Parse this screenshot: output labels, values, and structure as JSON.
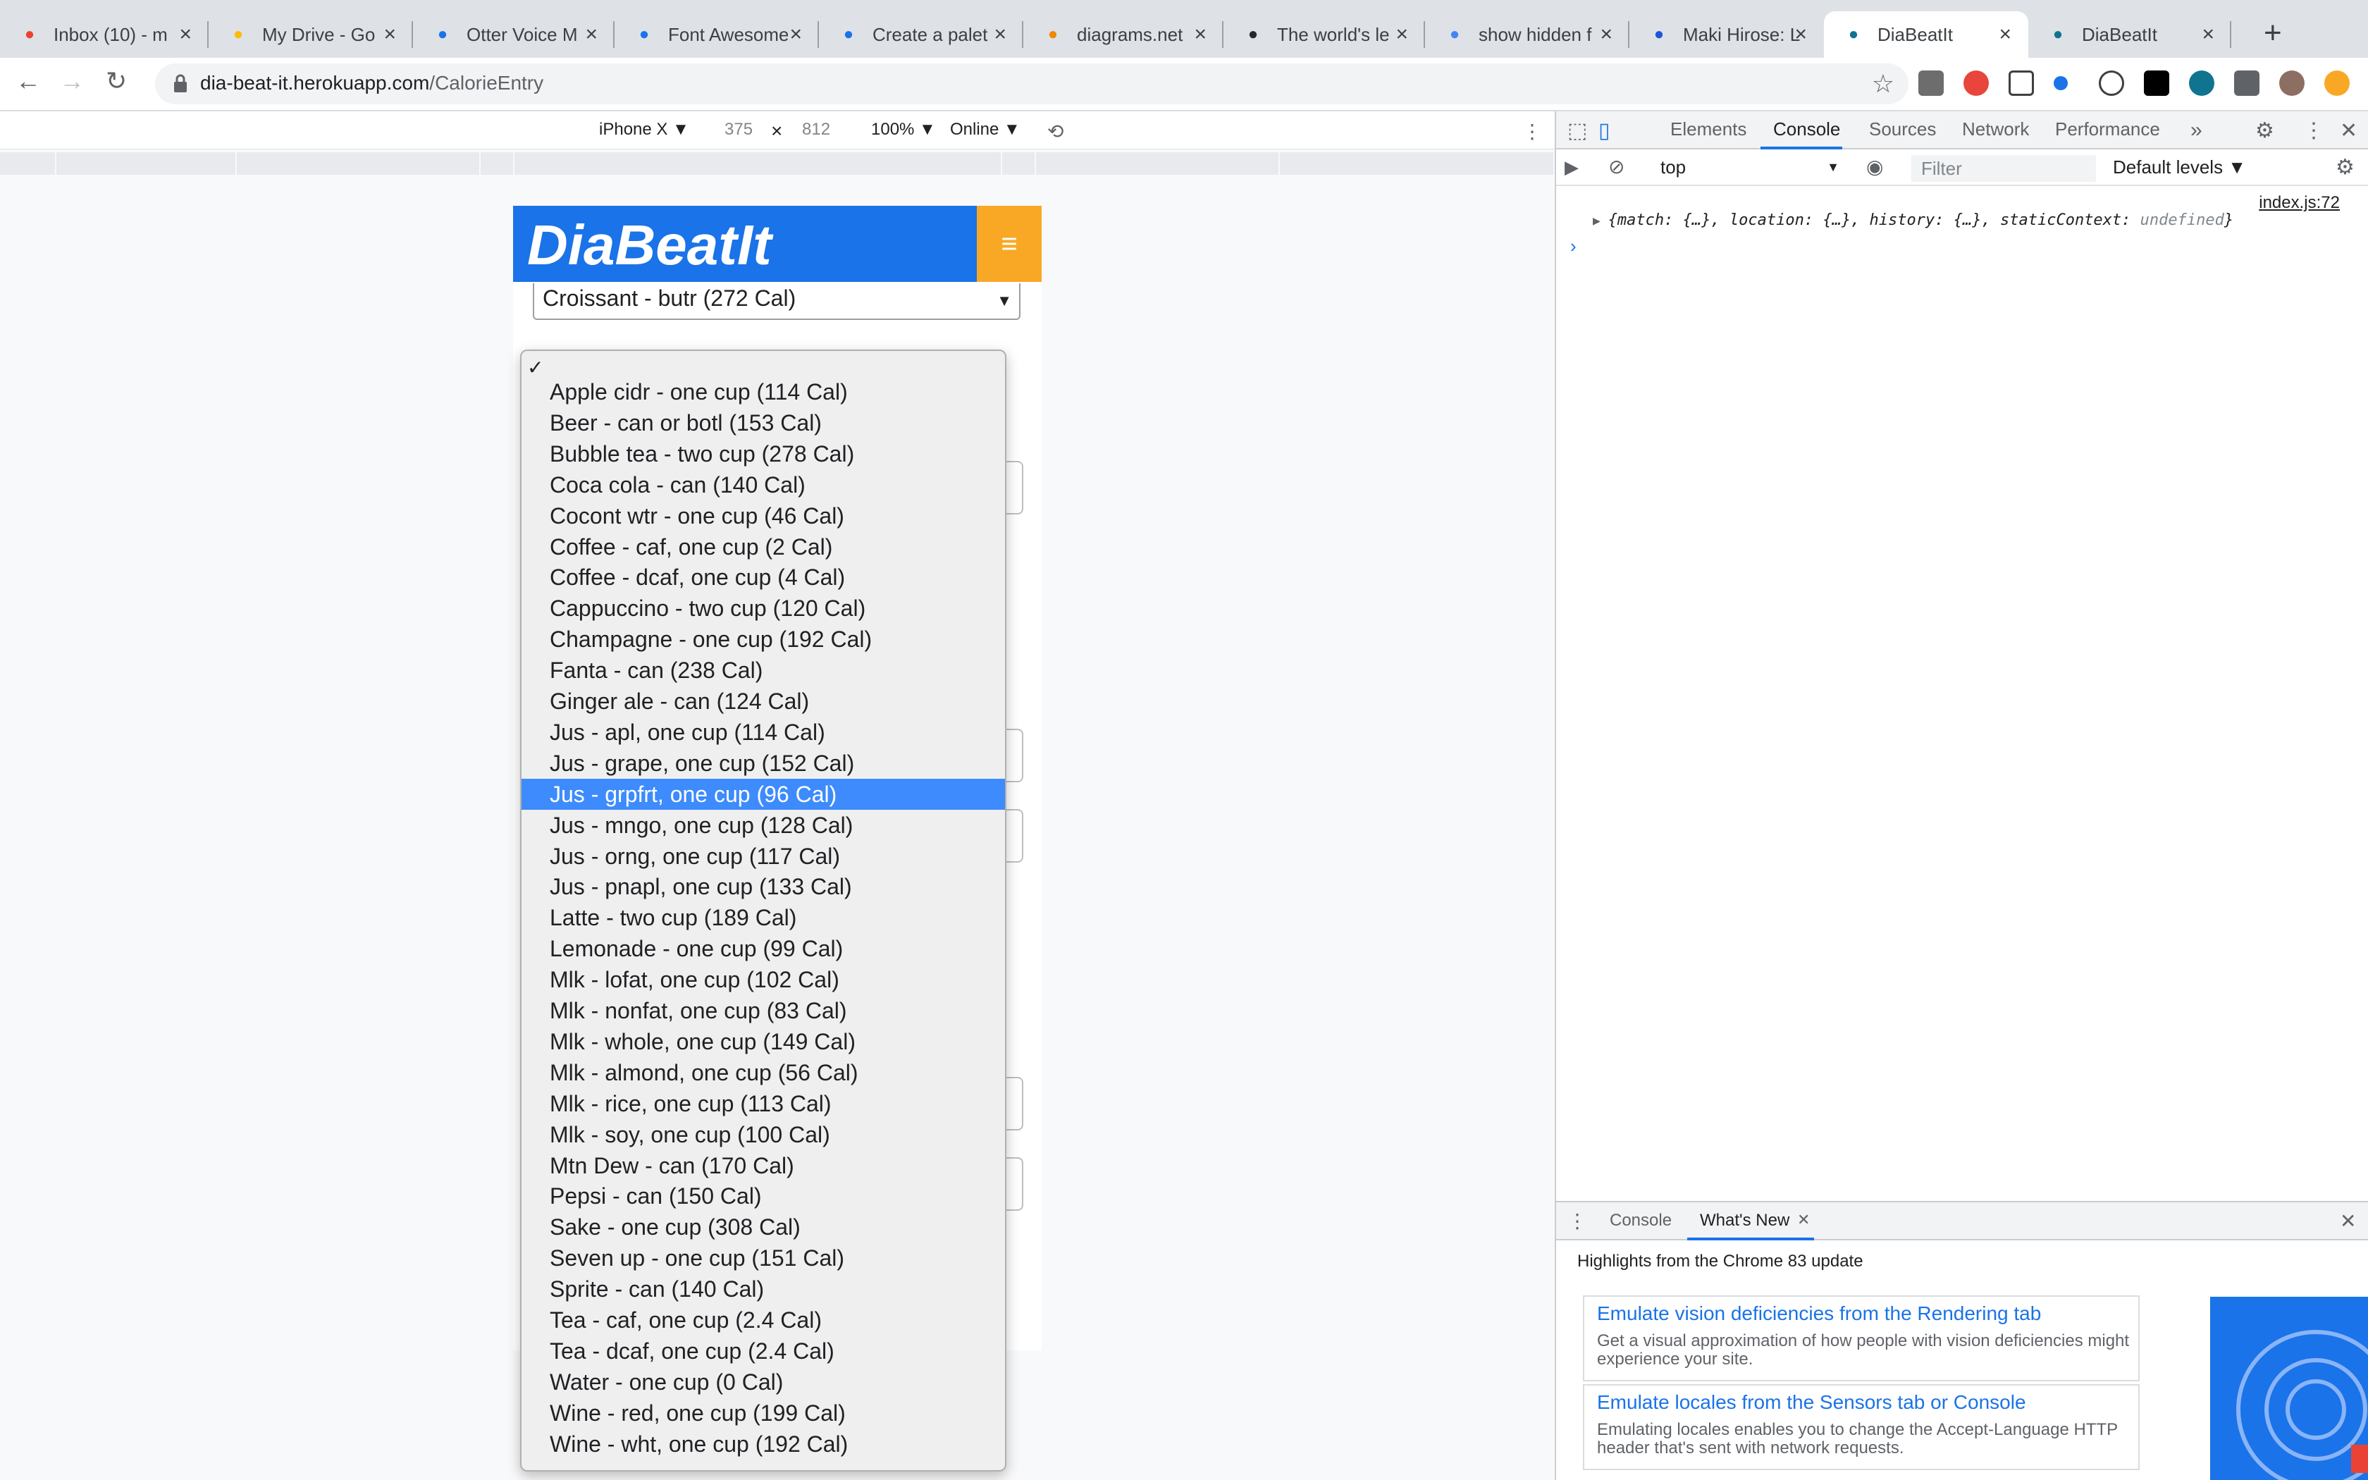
{
  "browser": {
    "tabs": [
      {
        "title": "Inbox (10) - m",
        "icon": "gmail-icon",
        "color": "#ea4335"
      },
      {
        "title": "My Drive - Go",
        "icon": "drive-icon",
        "color": "#fbbc04"
      },
      {
        "title": "Otter Voice M",
        "icon": "otter-icon",
        "color": "#1a73e8"
      },
      {
        "title": "Font Awesome",
        "icon": "flag-icon",
        "color": "#1a73e8"
      },
      {
        "title": "Create a palet",
        "icon": "coolors-icon",
        "color": "#1a73e8"
      },
      {
        "title": "diagrams.net",
        "icon": "diagrams-icon",
        "color": "#f08705"
      },
      {
        "title": "The world's le",
        "icon": "github-icon",
        "color": "#24292e"
      },
      {
        "title": "show hidden f",
        "icon": "google-icon",
        "color": "#4285f4"
      },
      {
        "title": "Maki Hirose: L",
        "icon": "square-icon",
        "color": "#1a56db"
      },
      {
        "title": "DiaBeatIt",
        "icon": "react-icon",
        "color": "#0e7490"
      },
      {
        "title": "DiaBeatIt",
        "icon": "react-icon",
        "color": "#0e7490"
      }
    ],
    "url_host": "dia-beat-it.herokuapp.com",
    "url_path": "/CalorieEntry"
  },
  "device": {
    "model": "iPhone X ▼",
    "width": "375",
    "times": "×",
    "height": "812",
    "zoom": "100% ▼",
    "network": "Online ▼"
  },
  "app": {
    "brand": "DiaBeatIt",
    "menu_icon": "≡",
    "selected_food": "Croissant - butr (272 Cal)"
  },
  "dropdown": {
    "check": "✓",
    "selected_index": 13,
    "options": [
      "Apple cidr - one cup (114 Cal)",
      "Beer - can or botl (153 Cal)",
      "Bubble tea - two cup (278 Cal)",
      "Coca cola - can (140 Cal)",
      "Cocont wtr - one cup (46 Cal)",
      "Coffee - caf, one cup (2 Cal)",
      "Coffee - dcaf, one cup (4 Cal)",
      "Cappuccino - two cup (120 Cal)",
      "Champagne - one cup (192 Cal)",
      "Fanta - can (238 Cal)",
      "Ginger ale - can (124 Cal)",
      "Jus - apl, one cup (114 Cal)",
      "Jus - grape, one cup (152 Cal)",
      "Jus - grpfrt, one cup (96 Cal)",
      "Jus - mngo, one cup (128 Cal)",
      "Jus - orng, one cup (117 Cal)",
      "Jus - pnapl, one cup (133 Cal)",
      "Latte - two cup (189 Cal)",
      "Lemonade - one cup (99 Cal)",
      "Mlk - lofat, one cup (102 Cal)",
      "Mlk - nonfat, one cup (83 Cal)",
      "Mlk - whole, one cup (149 Cal)",
      "Mlk - almond, one cup (56 Cal)",
      "Mlk - rice, one cup (113 Cal)",
      "Mlk - soy, one cup (100 Cal)",
      "Mtn Dew - can (170 Cal)",
      "Pepsi - can (150 Cal)",
      "Sake - one cup (308 Cal)",
      "Seven up - one cup (151 Cal)",
      "Sprite - can (140 Cal)",
      "Tea - caf, one cup (2.4 Cal)",
      "Tea - dcaf, one cup (2.4 Cal)",
      "Water - one cup (0 Cal)",
      "Wine - red, one cup (199 Cal)",
      "Wine - wht, one cup (192 Cal)"
    ]
  },
  "devtools": {
    "tabs": [
      "Elements",
      "Console",
      "Sources",
      "Network",
      "Performance"
    ],
    "more": "»",
    "context": "top",
    "filter_placeholder": "Filter",
    "levels": "Default levels ▼",
    "source_link": "index.js:72",
    "log": {
      "lead": "{match: {…}, location: {…}, history: {…}, staticContext: ",
      "undef": "undefined",
      "tail": "}"
    },
    "prompt": "›",
    "drawer_tabs": [
      "Console",
      "What's New"
    ],
    "highlights": "Highlights from the Chrome 83 update",
    "cards": [
      {
        "title": "Emulate vision deficiencies from the Rendering tab",
        "desc": "Get a visual approximation of how people with vision deficiencies might experience your site."
      },
      {
        "title": "Emulate locales from the Sensors tab or Console",
        "desc": "Emulating locales enables you to change the Accept-Language HTTP header that's sent with network requests."
      }
    ]
  },
  "colors": {
    "brand_blue": "#1a73e8",
    "menu_orange": "#f9a825",
    "option_highlight": "#3d8bfd"
  }
}
